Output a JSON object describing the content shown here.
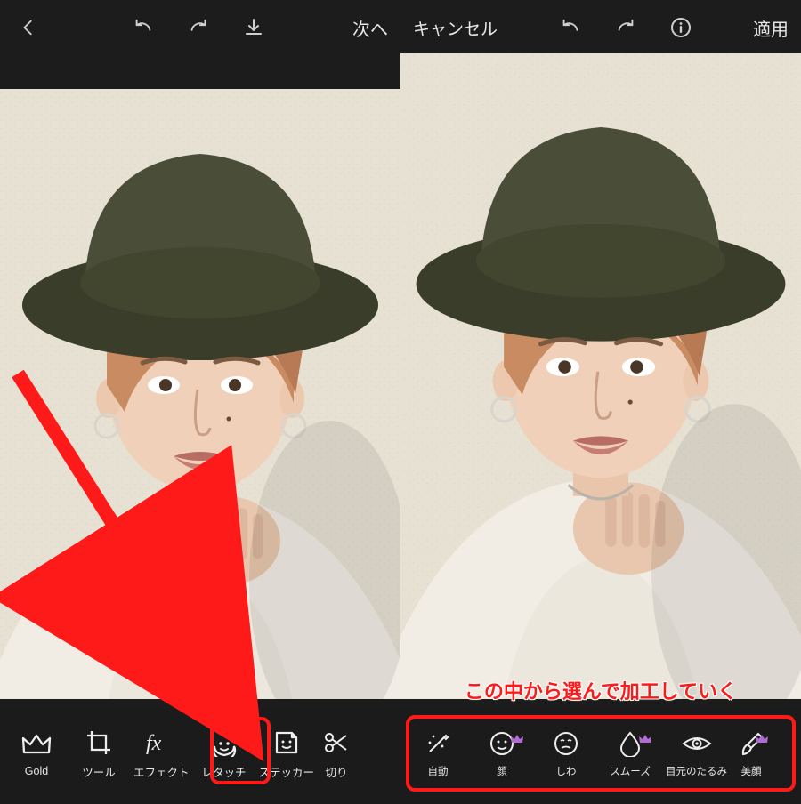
{
  "left": {
    "top": {
      "next_label": "次へ"
    },
    "tools": [
      {
        "id": "gold",
        "label": "Gold"
      },
      {
        "id": "tool",
        "label": "ツール"
      },
      {
        "id": "effect",
        "label": "エフェクト"
      },
      {
        "id": "retouch",
        "label": "レタッチ"
      },
      {
        "id": "sticker",
        "label": "ステッカー"
      },
      {
        "id": "crop",
        "label": "切り"
      }
    ]
  },
  "right": {
    "top": {
      "cancel_label": "キャンセル",
      "apply_label": "適用"
    },
    "caption": "この中から選んで加工していく",
    "tools": [
      {
        "id": "auto",
        "label": "自動",
        "premium": false
      },
      {
        "id": "face",
        "label": "顔",
        "premium": true
      },
      {
        "id": "wrinkle",
        "label": "しわ",
        "premium": false
      },
      {
        "id": "smooth",
        "label": "スムーズ",
        "premium": true
      },
      {
        "id": "eyebag",
        "label": "目元のたるみ",
        "premium": false
      },
      {
        "id": "beauty",
        "label": "美顔",
        "premium": true
      }
    ]
  }
}
